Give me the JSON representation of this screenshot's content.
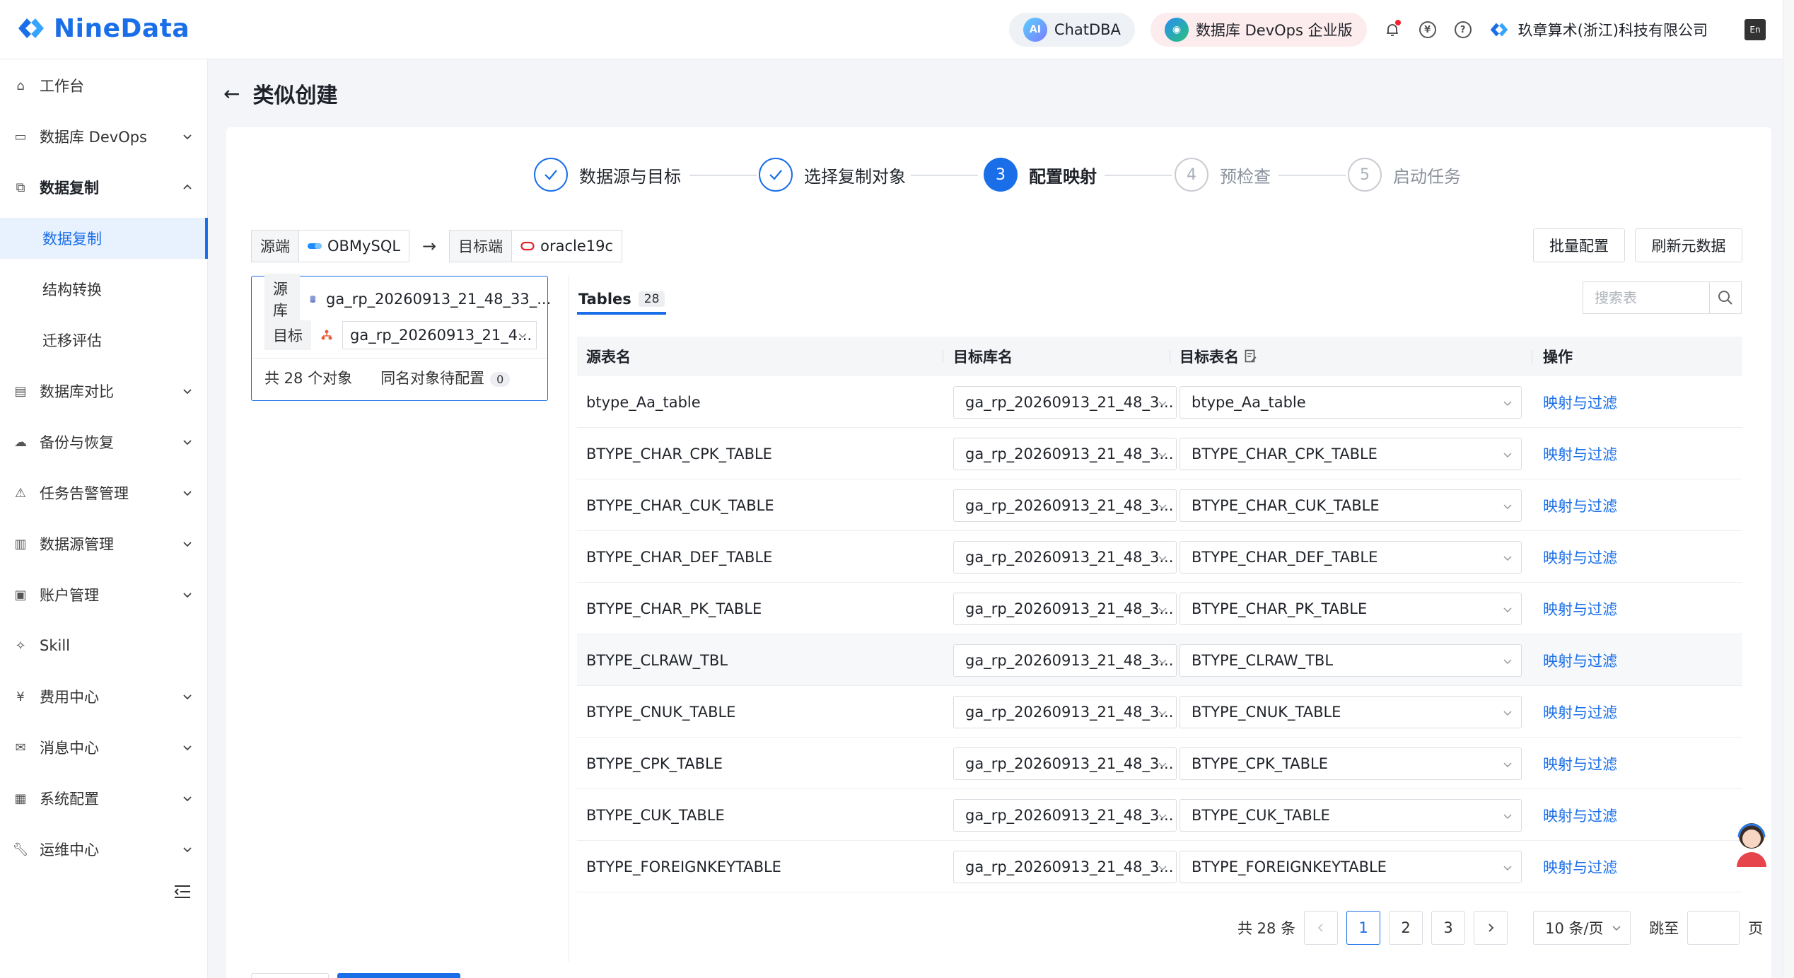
{
  "header": {
    "logo_text": "NineData",
    "chatdba": "ChatDBA",
    "chatdba_icon_text": "AI",
    "devops": "数据库 DevOps 企业版",
    "company": "玖章算术(浙江)科技有限公司",
    "lang_icon_text": "En"
  },
  "sidebar": {
    "items": [
      {
        "label": "工作台"
      },
      {
        "label": "数据库 DevOps"
      },
      {
        "label": "数据复制"
      },
      {
        "label": "数据库对比"
      },
      {
        "label": "备份与恢复"
      },
      {
        "label": "任务告警管理"
      },
      {
        "label": "数据源管理"
      },
      {
        "label": "账户管理"
      },
      {
        "label": "Skill"
      },
      {
        "label": "费用中心"
      },
      {
        "label": "消息中心"
      },
      {
        "label": "系统配置"
      },
      {
        "label": "运维中心"
      }
    ],
    "sub_items": [
      {
        "label": "数据复制"
      },
      {
        "label": "结构转换"
      },
      {
        "label": "迁移评估"
      }
    ]
  },
  "page": {
    "title": "类似创建"
  },
  "steps": [
    {
      "num": "1",
      "label": "数据源与目标",
      "state": "done"
    },
    {
      "num": "2",
      "label": "选择复制对象",
      "state": "done"
    },
    {
      "num": "3",
      "label": "配置映射",
      "state": "current"
    },
    {
      "num": "4",
      "label": "预检查",
      "state": "pending"
    },
    {
      "num": "5",
      "label": "启动任务",
      "state": "pending"
    }
  ],
  "source_bar": {
    "source_label": "源端",
    "source_value": "OBMySQL",
    "target_label": "目标端",
    "target_value": "oracle19c",
    "batch_config": "批量配置",
    "refresh_meta": "刷新元数据"
  },
  "left_panel": {
    "source_db_label": "源库",
    "source_db_value": "ga_rp_20260913_21_48_33_...",
    "target_label": "目标",
    "target_value": "ga_rp_20260913_21_4...",
    "total_objects": "共 28 个对象",
    "pending_label": "同名对象待配置",
    "pending_count": "0"
  },
  "tables_tab": {
    "label": "Tables",
    "count": "28",
    "search_placeholder": "搜索表"
  },
  "table": {
    "columns": [
      "源表名",
      "目标库名",
      "目标表名",
      "操作"
    ],
    "rows": [
      {
        "source": "btype_Aa_table",
        "target_db": "ga_rp_20260913_21_48_3...",
        "target_table": "btype_Aa_table",
        "action": "映射与过滤"
      },
      {
        "source": "BTYPE_CHAR_CPK_TABLE",
        "target_db": "ga_rp_20260913_21_48_3...",
        "target_table": "BTYPE_CHAR_CPK_TABLE",
        "action": "映射与过滤"
      },
      {
        "source": "BTYPE_CHAR_CUK_TABLE",
        "target_db": "ga_rp_20260913_21_48_3...",
        "target_table": "BTYPE_CHAR_CUK_TABLE",
        "action": "映射与过滤"
      },
      {
        "source": "BTYPE_CHAR_DEF_TABLE",
        "target_db": "ga_rp_20260913_21_48_3...",
        "target_table": "BTYPE_CHAR_DEF_TABLE",
        "action": "映射与过滤"
      },
      {
        "source": "BTYPE_CHAR_PK_TABLE",
        "target_db": "ga_rp_20260913_21_48_3...",
        "target_table": "BTYPE_CHAR_PK_TABLE",
        "action": "映射与过滤"
      },
      {
        "source": "BTYPE_CLRAW_TBL",
        "target_db": "ga_rp_20260913_21_48_3...",
        "target_table": "BTYPE_CLRAW_TBL",
        "action": "映射与过滤"
      },
      {
        "source": "BTYPE_CNUK_TABLE",
        "target_db": "ga_rp_20260913_21_48_3...",
        "target_table": "BTYPE_CNUK_TABLE",
        "action": "映射与过滤"
      },
      {
        "source": "BTYPE_CPK_TABLE",
        "target_db": "ga_rp_20260913_21_48_3...",
        "target_table": "BTYPE_CPK_TABLE",
        "action": "映射与过滤"
      },
      {
        "source": "BTYPE_CUK_TABLE",
        "target_db": "ga_rp_20260913_21_48_3...",
        "target_table": "BTYPE_CUK_TABLE",
        "action": "映射与过滤"
      },
      {
        "source": "BTYPE_FOREIGNKEYTABLE",
        "target_db": "ga_rp_20260913_21_48_3...",
        "target_table": "BTYPE_FOREIGNKEYTABLE",
        "action": "映射与过滤"
      }
    ]
  },
  "pagination": {
    "total": "共 28 条",
    "pages": [
      "1",
      "2",
      "3"
    ],
    "current": "1",
    "page_size": "10 条/页",
    "jump_label": "跳至",
    "page_unit": "页"
  },
  "colors": {
    "accent": "#1a6ee8",
    "link": "#1a6ee8",
    "border": "#d9dce1",
    "notify_dot": "#f5222d"
  }
}
